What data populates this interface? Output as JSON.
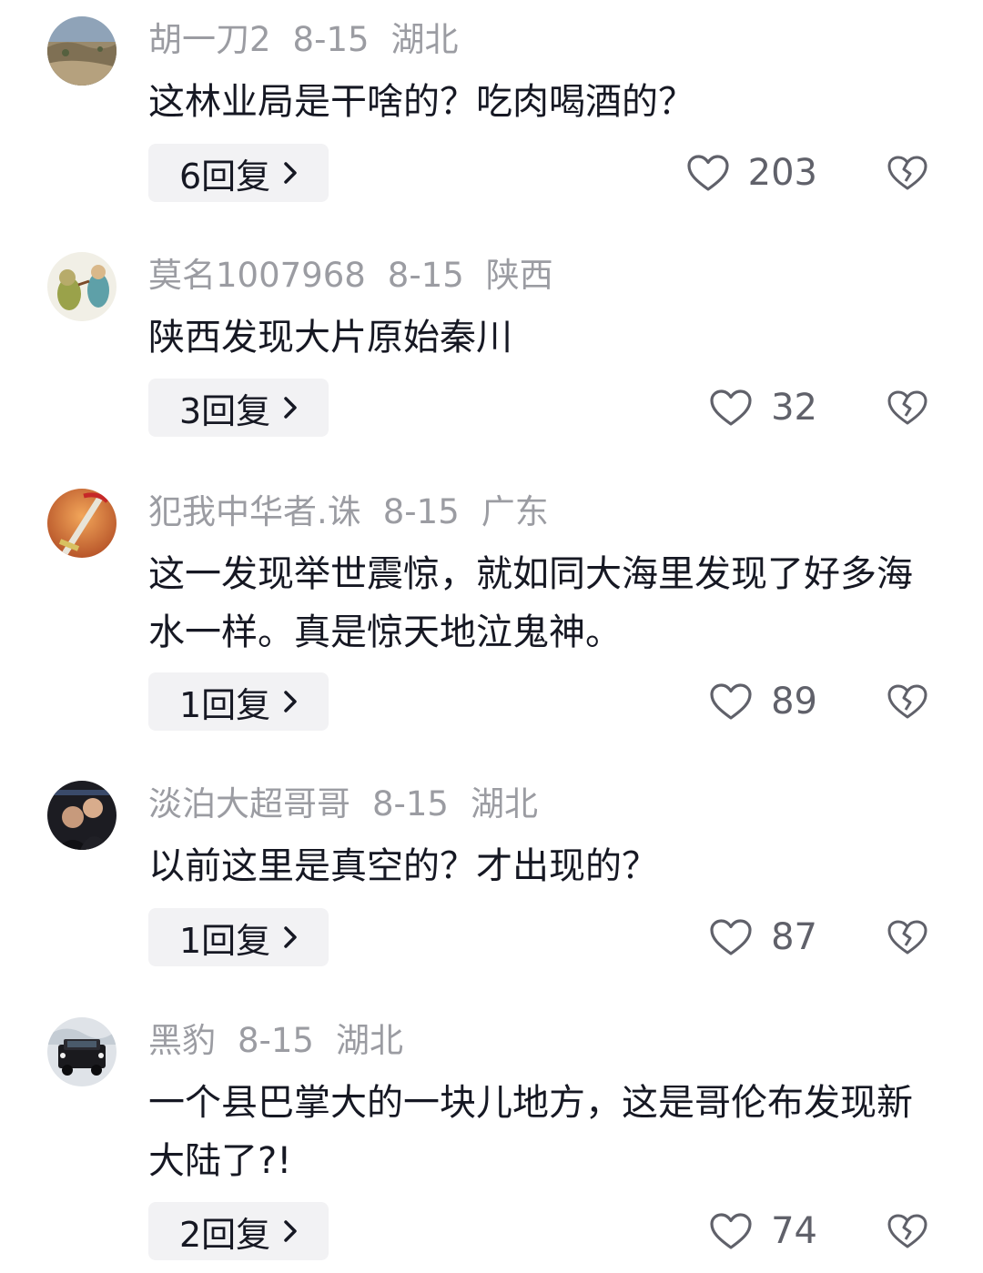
{
  "comments": [
    {
      "username": "胡一刀2",
      "date": "8-15",
      "location": "湖北",
      "text": "这林业局是干啥的？吃肉喝酒的？",
      "reply_label": "6回复",
      "likes": "203",
      "avatar_icon": "landscape-avatar"
    },
    {
      "username": "莫名1007968",
      "date": "8-15",
      "location": "陕西",
      "text": "陕西发现大片原始秦川",
      "reply_label": "3回复",
      "likes": "32",
      "avatar_icon": "cartoon-avatar"
    },
    {
      "username": "犯我中华者.诛",
      "date": "8-15",
      "location": "广东",
      "text": "这一发现举世震惊，就如同大海里发现了好多海水一样。真是惊天地泣鬼神。",
      "reply_label": "1回复",
      "likes": "89",
      "avatar_icon": "sword-avatar"
    },
    {
      "username": "淡泊大超哥哥",
      "date": "8-15",
      "location": "湖北",
      "text": "以前这里是真空的？才出现的？",
      "reply_label": "1回复",
      "likes": "87",
      "avatar_icon": "photo-avatar"
    },
    {
      "username": "黑豹",
      "date": "8-15",
      "location": "湖北",
      "text": "一个县巴掌大的一块儿地方，这是哥伦布发现新大陆了?!",
      "reply_label": "2回复",
      "likes": "74",
      "avatar_icon": "car-avatar"
    }
  ],
  "colors": {
    "meta_text": "#9b9ca2",
    "body_text": "#161823",
    "reply_bg": "#f2f2f4",
    "like_text": "#60616a"
  }
}
